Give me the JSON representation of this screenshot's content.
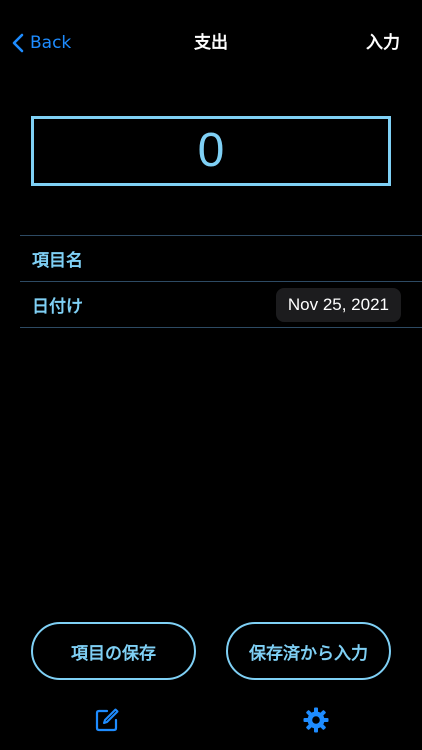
{
  "navbar": {
    "back_label": "Back",
    "title": "支出",
    "action_label": "入力"
  },
  "amount": {
    "value": "0"
  },
  "form": {
    "item_name_label": "項目名",
    "date_label": "日付け",
    "date_value": "Nov 25, 2021"
  },
  "actions": {
    "save_item_label": "項目の保存",
    "input_from_saved_label": "保存済から入力"
  },
  "toolbar": {
    "icons": [
      "compose-icon",
      "gear-icon"
    ]
  },
  "colors": {
    "background": "#000000",
    "accent": "#7fd0f5",
    "link_blue": "#1e8cff",
    "pill_bg": "#1c1c1e",
    "separator": "#2d4a63"
  }
}
